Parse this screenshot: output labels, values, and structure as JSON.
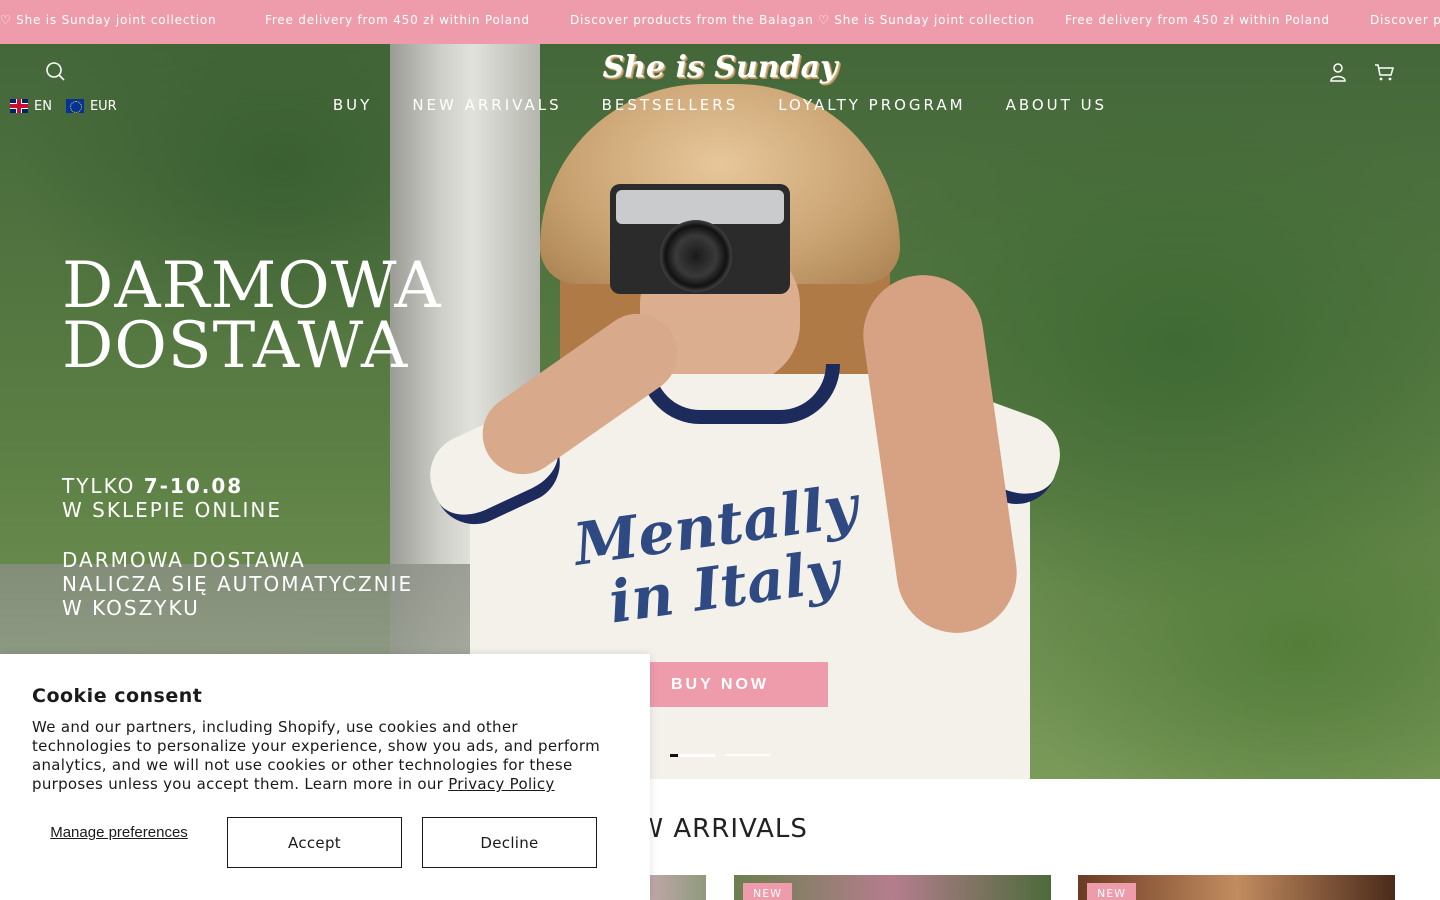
{
  "announcement": {
    "items": [
      "♡ She is Sunday joint collection",
      "Free delivery from 450 zł within Poland",
      "Discover products from the Balagan ♡ She is Sunday joint collection",
      "Free delivery from 450 zł within Poland",
      "Discover pr"
    ],
    "background": "#ee9bac"
  },
  "header": {
    "logo": "She is Sunday",
    "language": "EN",
    "currency": "EUR",
    "icons": [
      "search-icon",
      "account-icon",
      "cart-icon",
      "flag-uk-icon",
      "flag-eu-icon"
    ]
  },
  "nav": {
    "items": [
      {
        "label": "BUY"
      },
      {
        "label": "NEW ARRIVALS"
      },
      {
        "label": "BESTSELLERS"
      },
      {
        "label": "LOYALTY PROGRAM"
      },
      {
        "label": "ABOUT US"
      }
    ]
  },
  "hero": {
    "headline_line1": "DARMOWA",
    "headline_line2": "DOSTAWA",
    "promo_prefix": "TYLKO ",
    "promo_dates": "7-10.08",
    "promo_line2": "W SKLEPIE ONLINE",
    "promo_line3": "DARMOWA DOSTAWA",
    "promo_line4": "NALICZA SIĘ AUTOMATYCZNIE",
    "promo_line5": "W KOSZYKU",
    "tshirt_line1": "Mentally",
    "tshirt_line2": "in Italy",
    "cta_label": "BUY NOW",
    "slide_count": 2,
    "active_slide": 1
  },
  "new_arrivals": {
    "title": "NEW ARRIVALS",
    "visible_title": "EW ARRIVALS",
    "badges": [
      "NEW",
      "NEW"
    ]
  },
  "cookie": {
    "title": "Cookie consent",
    "text": "We and our partners, including Shopify, use cookies and other technologies to personalize your experience, show you ads, and perform analytics, and we will not use cookies or other technologies for these purposes unless you accept them. Learn more in our ",
    "link_label": "Privacy Policy",
    "manage_label": "Manage preferences",
    "accept_label": "Accept",
    "decline_label": "Decline"
  }
}
